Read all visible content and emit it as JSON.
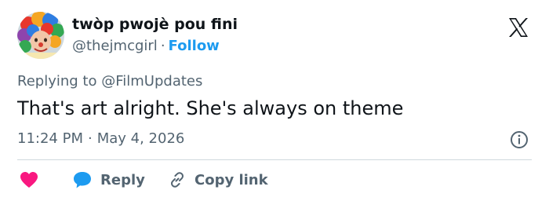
{
  "author": {
    "display_name": "twòp pwojè pou fini",
    "handle": "@thejmcgirl",
    "separator": "·",
    "follow_label": "Follow"
  },
  "reply_context": {
    "prefix": "Replying to",
    "mention": "@FilmUpdates"
  },
  "tweet": {
    "text": "That's art alright. She's always on theme",
    "time": "11:24 PM",
    "separator": "·",
    "date": "May 4, 2026"
  },
  "actions": {
    "reply_label": "Reply",
    "copy_link_label": "Copy link"
  },
  "icons": {
    "logo": "x-logo-icon",
    "info": "info-icon",
    "like": "heart-icon",
    "reply": "speech-bubble-icon",
    "copy": "link-icon"
  },
  "colors": {
    "accent": "#1d9bf0",
    "like": "#f91880",
    "text": "#0f1419",
    "muted": "#536471",
    "divider": "#cfd9de"
  }
}
